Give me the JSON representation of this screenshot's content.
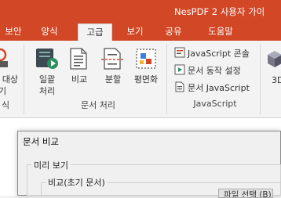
{
  "window": {
    "title": "NesPDF 2  사용자 가이"
  },
  "tabs": [
    {
      "label": "보안",
      "active": false
    },
    {
      "label": "양식",
      "active": false
    },
    {
      "label": "고급",
      "active": true
    },
    {
      "label": "보기",
      "active": false
    },
    {
      "label": "공유",
      "active": false
    },
    {
      "label": "도움말",
      "active": false
    }
  ],
  "ribbon": {
    "partial_group": {
      "button_label_line1": "대상",
      "button_label_line2": "기",
      "group_label": "식"
    },
    "doc_processing": {
      "group_label": "문서 처리",
      "buttons": [
        {
          "line1": "일괄",
          "line2": "처리",
          "icon": "batch-process-icon"
        },
        {
          "line1": "비교",
          "line2": "",
          "icon": "compare-icon"
        },
        {
          "line1": "분할",
          "line2": "",
          "icon": "split-icon"
        },
        {
          "line1": "평면화",
          "line2": "",
          "icon": "flatten-icon"
        }
      ]
    },
    "javascript": {
      "group_label": "JavaScript",
      "items": [
        {
          "label": "JavaScript 콘솔",
          "icon": "javascript-console-icon"
        },
        {
          "label": "문서 동작 설정",
          "icon": "document-action-icon"
        },
        {
          "label": "문서 JavaScript",
          "icon": "document-javascript-icon"
        }
      ]
    },
    "partial_3d": {
      "label": "3D"
    }
  },
  "dialog": {
    "title": "문서 비교",
    "preview_legend": "미리 보기",
    "original_legend": "비교(초기 문서)",
    "browse_button": "파일 선택 (B)..."
  },
  "colors": {
    "accent": "#d24726",
    "ribbon_bg": "#f3f3f3"
  }
}
